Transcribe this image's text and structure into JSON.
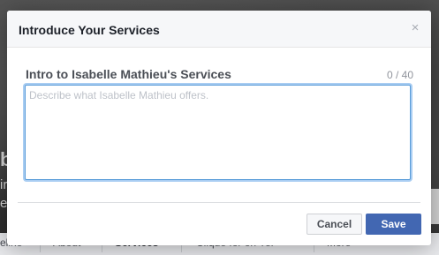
{
  "background": {
    "partial_texts": [
      "b",
      "ir",
      "e"
    ],
    "nav_items": [
      "eline",
      "About",
      "Services",
      "Clique for on Yer",
      "More"
    ],
    "active_nav": "Services"
  },
  "dialog": {
    "title": "Introduce Your Services",
    "close_icon": "×",
    "field_label": "Intro to Isabelle Mathieu's Services",
    "char_count": "0 / 40",
    "textarea": {
      "value": "",
      "placeholder": "Describe what Isabelle Mathieu offers."
    },
    "buttons": {
      "cancel": "Cancel",
      "save": "Save"
    }
  },
  "colors": {
    "primary_button": "#4267b2",
    "focus_ring": "#5b9dd9"
  }
}
